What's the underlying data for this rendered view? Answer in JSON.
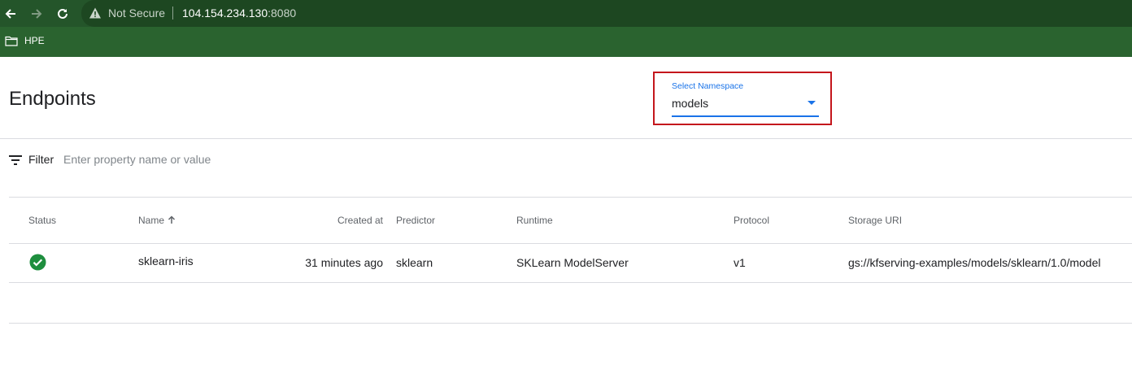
{
  "browser": {
    "security_label": "Not Secure",
    "url_host": "104.154.234.130",
    "url_port": ":8080",
    "bookmarks": [
      {
        "label": "HPE",
        "icon": "folder-icon"
      }
    ]
  },
  "page": {
    "title": "Endpoints"
  },
  "namespace": {
    "label": "Select Namespace",
    "value": "models",
    "icon": "dropdown-arrow-icon"
  },
  "filter": {
    "label": "Filter",
    "placeholder": "Enter property name or value",
    "icon": "filter-icon"
  },
  "table": {
    "headers": {
      "status": "Status",
      "name": "Name",
      "created": "Created at",
      "predictor": "Predictor",
      "runtime": "Runtime",
      "protocol": "Protocol",
      "storage": "Storage URI"
    },
    "sort_icon": "arrow-up-icon",
    "rows": [
      {
        "status_icon": "check-circle-icon",
        "name": "sklearn-iris",
        "created": "31 minutes ago",
        "predictor": "sklearn",
        "runtime": "SKLearn ModelServer",
        "protocol": "v1",
        "storage": "gs://kfserving-examples/models/sklearn/1.0/model"
      }
    ]
  },
  "colors": {
    "chrome": "#24552a",
    "accent": "#1a73e8",
    "highlight": "#c4161c",
    "success": "#1e8e3e"
  }
}
